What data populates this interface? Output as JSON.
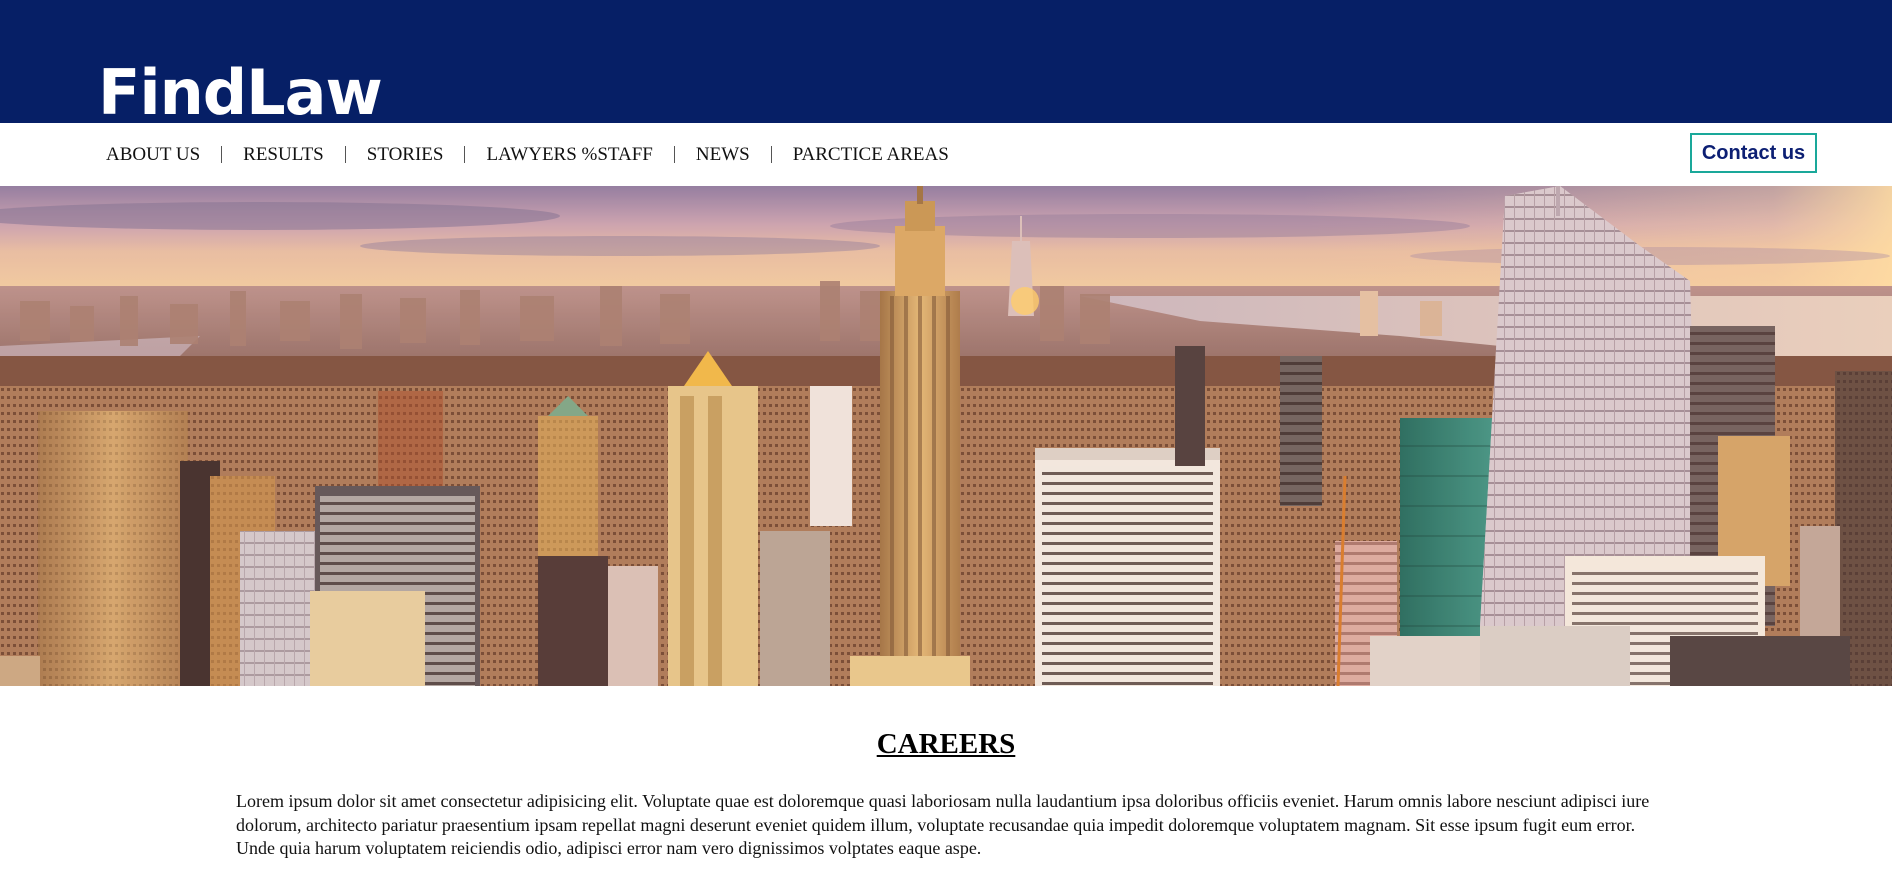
{
  "header": {
    "logo_text": "FindLaw",
    "background_color": "#061f66"
  },
  "nav": {
    "items": [
      {
        "label": "ABOUT US"
      },
      {
        "label": "RESULTS"
      },
      {
        "label": "STORIES"
      },
      {
        "label": "LAWYERS %STAFF"
      },
      {
        "label": "NEWS"
      },
      {
        "label": "PARCTICE AREAS"
      }
    ],
    "contact_label": "Contact us",
    "contact_border_color": "#1aa89a",
    "contact_text_color": "#0c1f73"
  },
  "hero": {
    "image": "city-skyline-photo"
  },
  "section": {
    "title": "CAREERS",
    "body": "Lorem ipsum dolor sit amet consectetur adipisicing elit. Voluptate quae est doloremque quasi laboriosam nulla laudantium ipsa doloribus officiis eveniet. Harum omnis labore nesciunt adipisci iure dolorum, architecto pariatur praesentium ipsam repellat magni deserunt eveniet quidem illum, voluptate recusandae quia impedit doloremque voluptatem magnam. Sit esse ipsum fugit eum error. Unde quia harum voluptatem reiciendis odio, adipisci error nam vero dignissimos volptates eaque aspe."
  }
}
